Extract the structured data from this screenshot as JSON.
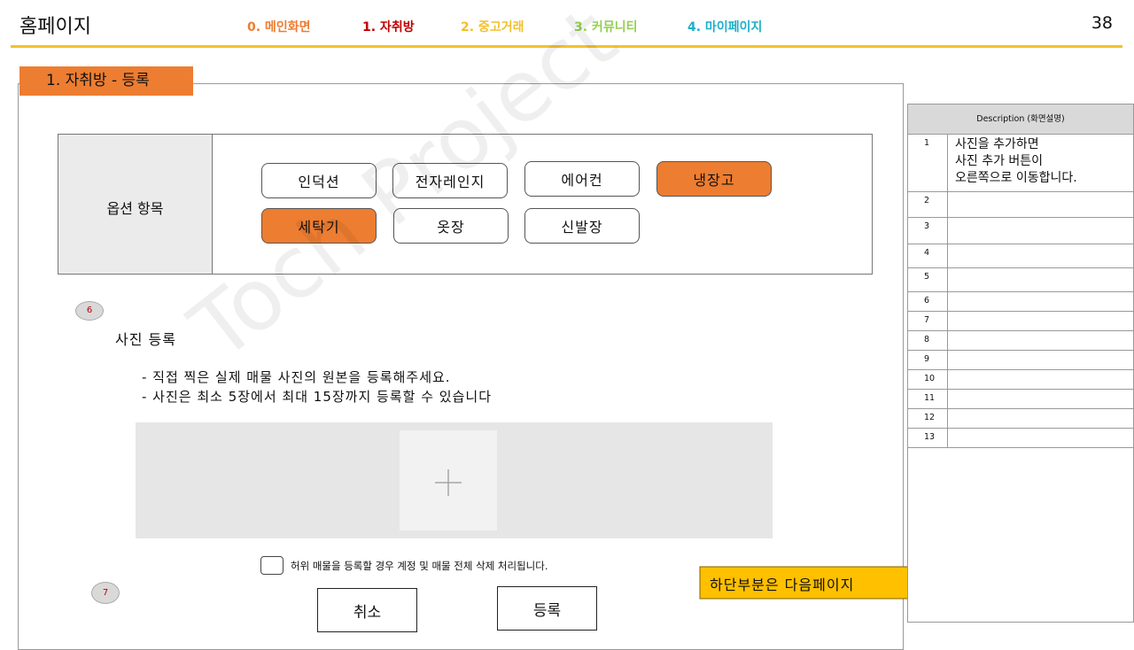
{
  "header": {
    "title": "홈페이지",
    "page_number": "38",
    "nav": [
      {
        "label": "0. 메인화면",
        "color": "#ed7d31"
      },
      {
        "label": "1. 자취방",
        "color": "#c00000"
      },
      {
        "label": "2. 중고거래",
        "color": "#f2c12e"
      },
      {
        "label": "3. 커뮤니티",
        "color": "#92d050"
      },
      {
        "label": "4. 마이페이지",
        "color": "#1cb0c8"
      }
    ],
    "accent_line_color": "#f2c12e"
  },
  "section": {
    "tag": "1. 자취방 - 등록"
  },
  "options": {
    "label": "옵션 항목",
    "items": [
      {
        "label": "인덕션",
        "selected": false
      },
      {
        "label": "전자레인지",
        "selected": false
      },
      {
        "label": "에어컨",
        "selected": false
      },
      {
        "label": "냉장고",
        "selected": true
      },
      {
        "label": "세탁기",
        "selected": true
      },
      {
        "label": "옷장",
        "selected": false
      },
      {
        "label": "신발장",
        "selected": false
      }
    ]
  },
  "markers": {
    "photo": "6",
    "agree": "7"
  },
  "photo": {
    "title": "사진 등록",
    "guides": [
      "- 직접 찍은 실제 매물 사진의 원본을 등록해주세요.",
      "- 사진은 최소 5장에서 최대 15장까지 등록할 수 있습니다"
    ],
    "add_icon": "plus-icon"
  },
  "agreement": {
    "text": "허위 매물을 등록할 경우 계정 및 매물 전체 삭제 처리됩니다."
  },
  "buttons": {
    "cancel": "취소",
    "register": "등록"
  },
  "callout": {
    "label": "하단부분은 다음페이지",
    "color": "#ffc000"
  },
  "watermark": "Toch Project",
  "description": {
    "header": "Description (화면설명)",
    "rows": [
      {
        "num": "1",
        "text": "사진을 추가하면\n사진 추가 버튼이\n오른쪽으로 이동합니다."
      },
      {
        "num": "2",
        "text": ""
      },
      {
        "num": "3",
        "text": ""
      },
      {
        "num": "4",
        "text": ""
      },
      {
        "num": "5",
        "text": ""
      },
      {
        "num": "6",
        "text": ""
      },
      {
        "num": "7",
        "text": ""
      },
      {
        "num": "8",
        "text": ""
      },
      {
        "num": "9",
        "text": ""
      },
      {
        "num": "10",
        "text": ""
      },
      {
        "num": "11",
        "text": ""
      },
      {
        "num": "12",
        "text": ""
      },
      {
        "num": "13",
        "text": ""
      }
    ]
  }
}
